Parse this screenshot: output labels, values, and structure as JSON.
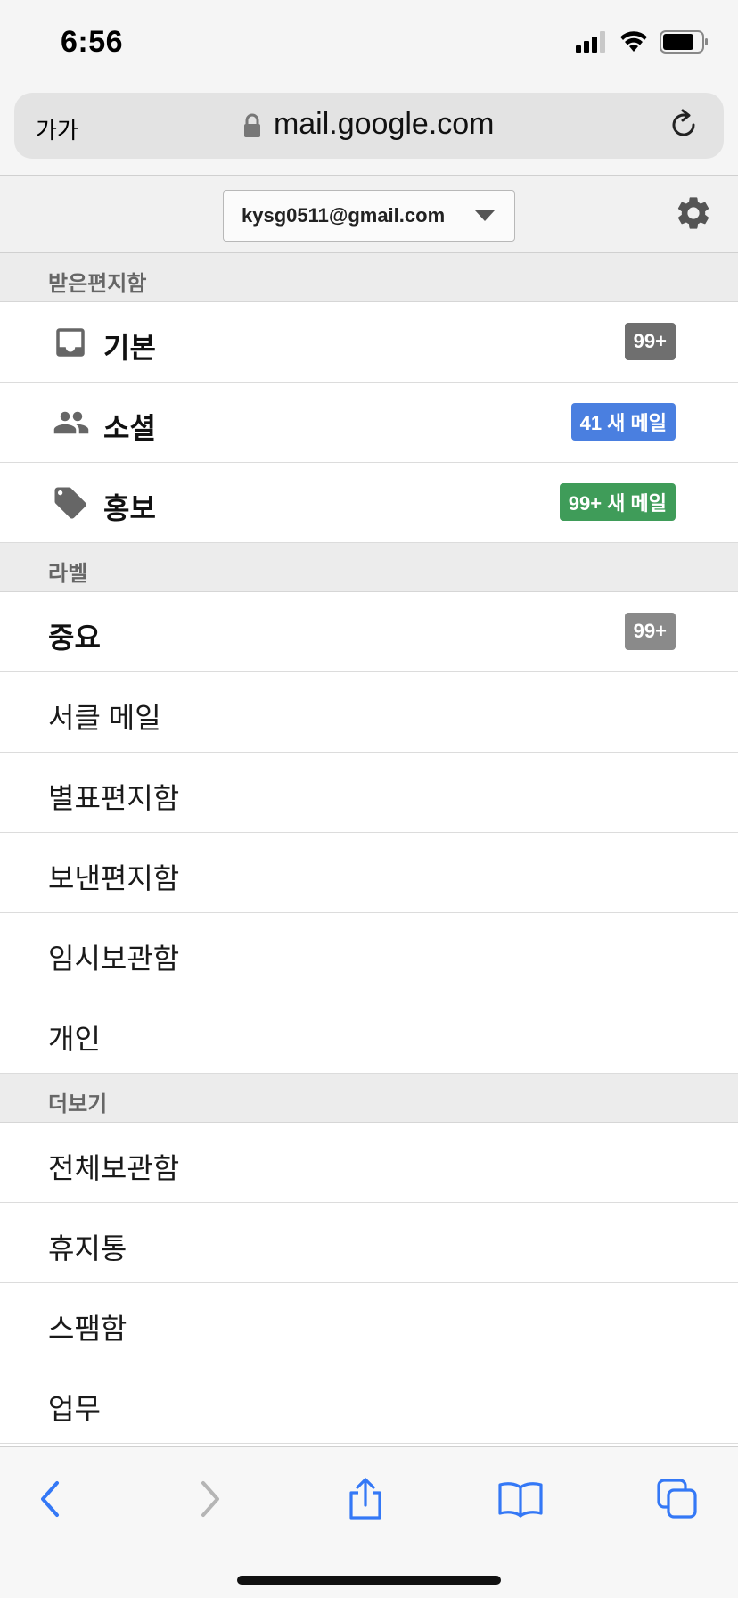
{
  "status_bar": {
    "time": "6:56"
  },
  "browser": {
    "text_size_label": "가가",
    "url": "mail.google.com"
  },
  "account": {
    "email": "kysg0511@gmail.com"
  },
  "sections": {
    "inbox_header": "받은편지함",
    "labels_header": "라벨",
    "more_header": "더보기"
  },
  "inbox_items": [
    {
      "label": "기본",
      "icon": "inbox-icon",
      "badge": "99+",
      "badge_color": "#6f6f6f"
    },
    {
      "label": "소셜",
      "icon": "people-icon",
      "badge": "41 새 메일",
      "badge_color": "#4a7fe0"
    },
    {
      "label": "홍보",
      "icon": "tag-icon",
      "badge": "99+ 새 메일",
      "badge_color": "#3f9c59"
    }
  ],
  "label_items": [
    {
      "label": "중요",
      "badge": "99+",
      "badge_color": "#8a8a8a"
    },
    {
      "label": "서클 메일"
    },
    {
      "label": "별표편지함"
    },
    {
      "label": "보낸편지함"
    },
    {
      "label": "임시보관함"
    },
    {
      "label": "개인"
    }
  ],
  "more_items": [
    {
      "label": "전체보관함"
    },
    {
      "label": "휴지통"
    },
    {
      "label": "스팸함"
    },
    {
      "label": "업무"
    }
  ],
  "colors": {
    "accent": "#3478f6",
    "disabled": "#b5b5b5"
  }
}
